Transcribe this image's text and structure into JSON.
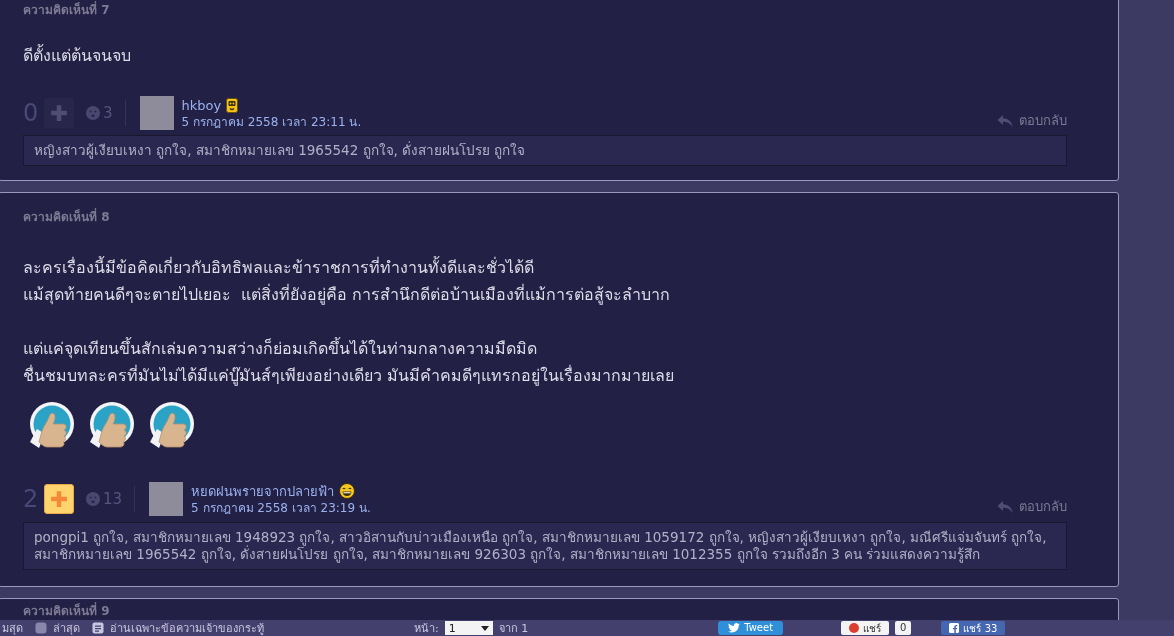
{
  "comments": [
    {
      "header": "ความคิดเห็นที่ 7",
      "paragraphs": [
        "ดีตั้งแต่ต้นจนจบ"
      ],
      "votes": "0",
      "voted": false,
      "emotion_count": "3",
      "author": {
        "name": "hkboy",
        "badge": {
          "kind": "robot"
        },
        "date": "5 กรกฎาคม 2558 เวลา 23:11 น."
      },
      "reply": "ตอบกลับ",
      "likers": "หญิงสาวผู้เงียบเหงา ถูกใจ, สมาชิกหมายเลข 1965542 ถูกใจ, ดั่งสายฝนโปรย ถูกใจ"
    },
    {
      "header": "ความคิดเห็นที่ 8",
      "paragraphs": [
        "ละครเรื่องนี้มีข้อคิดเกี่ยวกับอิทธิพลและข้าราชการที่ทำงานทั้งดีและชั่วได้ดี\nแม้สุดท้ายคนดีๆจะตายไปเยอะ  แต่สิ่งที่ยังอยู่คือ การสำนึกดีต่อบ้านเมืองที่แม้การต่อสู้จะลำบาก",
        "แต่แค่จุดเทียนขึ้นสักเล่มความสว่างก็ย่อมเกิดขึ้นได้ในท่ามกลางความมืดมิด\nชื่นชมบทละครที่มันไม่ได้มีแค่บู๊มันส์ๆเพียงอย่างเดียว มันมีคำคมดีๆแทรกอยู่ในเรื่องมากมายเลย"
      ],
      "stickers": [
        {
          "kind": "thumbs-up"
        },
        {
          "kind": "thumbs-up"
        },
        {
          "kind": "thumbs-up"
        }
      ],
      "votes": "2",
      "voted": true,
      "emotion_count": "13",
      "author": {
        "name": "หยดฝนพรายจากปลายฟ้า",
        "badge": {
          "kind": "laugh"
        },
        "date": "5 กรกฎาคม 2558 เวลา 23:19 น."
      },
      "reply": "ตอบกลับ",
      "likers": "pongpi1 ถูกใจ, สมาชิกหมายเลข 1948923 ถูกใจ, สาวอิสานกับบ่าวเมืองเหนือ ถูกใจ, สมาชิกหมายเลข 1059172 ถูกใจ, หญิงสาวผู้เงียบเหงา ถูกใจ, มณีศรีแจ่มจันทร์ ถูกใจ, สมาชิกหมายเลข 1965542 ถูกใจ, ดั่งสายฝนโปรย ถูกใจ, สมาชิกหมายเลข 926303 ถูกใจ, สมาชิกหมายเลข 1012355 ถูกใจ รวมถึงอีก 3 คน ร่วมแสดงความรู้สึก"
    },
    {
      "header": "ความคิดเห็นที่ 9"
    }
  ],
  "bottom_bar": {
    "links": [
      {
        "label": "มสุด",
        "kind": "plain"
      },
      {
        "label": "ล่าสุด",
        "kind": "square"
      },
      {
        "label": "อ่านเฉพาะข้อความเจ้าของกระทู้",
        "kind": "owner"
      }
    ],
    "page_label": "หน้า:",
    "page_value": "1",
    "page_total": "จาก 1",
    "tweet": "Tweet",
    "share": {
      "label": "แชร์",
      "count": "0"
    },
    "facebook": {
      "label": "แชร์ 33"
    }
  }
}
